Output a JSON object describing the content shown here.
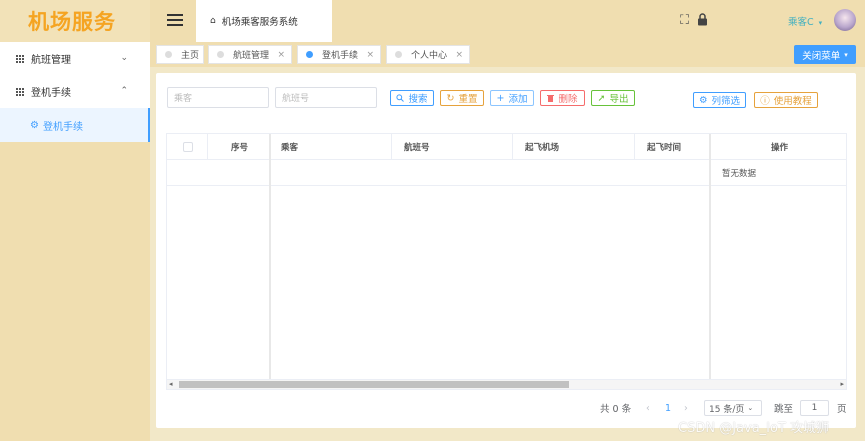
{
  "app": {
    "logo": "机场服务",
    "breadcrumb": "机场乘客服务系统",
    "user": "乘客C"
  },
  "sidebar": {
    "items": [
      {
        "label": "航班管理",
        "chevron": "⌄"
      },
      {
        "label": "登机手续",
        "chevron": "⌃"
      }
    ],
    "sub_item": "登机手续"
  },
  "tabs": [
    {
      "label": "主页",
      "closable": false
    },
    {
      "label": "航班管理",
      "closable": true
    },
    {
      "label": "登机手续",
      "closable": true,
      "active": true
    },
    {
      "label": "个人中心",
      "closable": true
    }
  ],
  "tab_close_char": "×",
  "close_menu": "关闭菜单",
  "search": {
    "passenger_placeholder": "乘客",
    "flight_placeholder": "航班号"
  },
  "buttons": {
    "search": "搜索",
    "reset": "重置",
    "add": "添加",
    "delete": "删除",
    "export": "导出",
    "column_filter": "列筛选",
    "tutorial": "使用教程"
  },
  "table": {
    "columns": [
      "序号",
      "乘客",
      "航班号",
      "起飞机场",
      "起飞时间",
      "操作"
    ],
    "empty_text": "暂无数据"
  },
  "pagination": {
    "total": "共 0 条",
    "prev": "‹",
    "current": "1",
    "next": "›",
    "page_size": "15 条/页",
    "jump_label": "跳至",
    "jump_value": "1",
    "page_suffix": "页"
  },
  "watermark": "CSDN @Java_IoT 攻城狮",
  "colors": {
    "primary": "#409eff",
    "warning": "#e6a23c",
    "danger": "#f56c6c",
    "success": "#67c23a",
    "logo": "#f5a422",
    "sidebar_bg": "#f0deb0"
  }
}
